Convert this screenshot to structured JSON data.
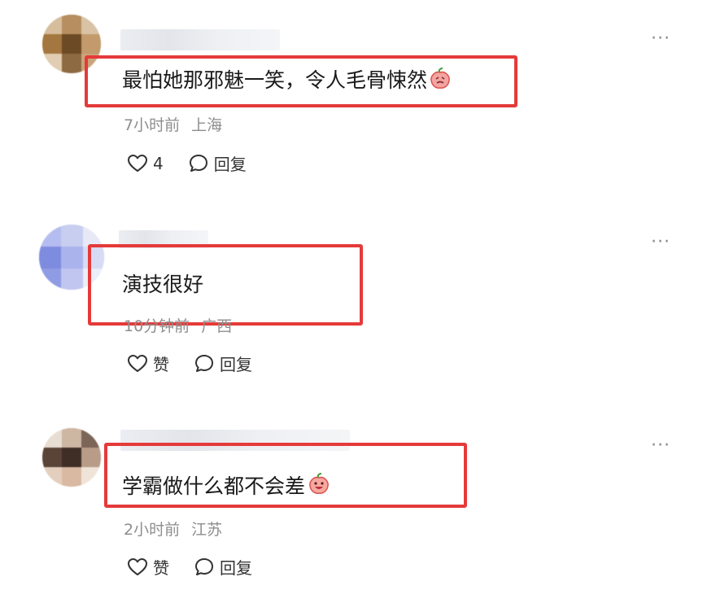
{
  "comments": [
    {
      "text": "最怕她那邪魅一笑，令人毛骨悚然",
      "time": "7小时前",
      "location": "上海",
      "like_count": "4",
      "reply_label": "回复",
      "more": "···"
    },
    {
      "text": "演技很好",
      "time": "10分钟前",
      "location": "广西",
      "like_label": "赞",
      "reply_label": "回复",
      "more": "···"
    },
    {
      "text": "学霸做什么都不会差",
      "time": "2小时前",
      "location": "江苏",
      "like_label": "赞",
      "reply_label": "回复",
      "more": "···"
    }
  ],
  "colors": {
    "highlight": "#e53a3a",
    "meta": "#8e8e8e",
    "text": "#1a1a1a"
  },
  "icons": [
    "heart-icon",
    "speech-bubble-icon",
    "more-dots-icon",
    "peach-emoji-icon"
  ]
}
